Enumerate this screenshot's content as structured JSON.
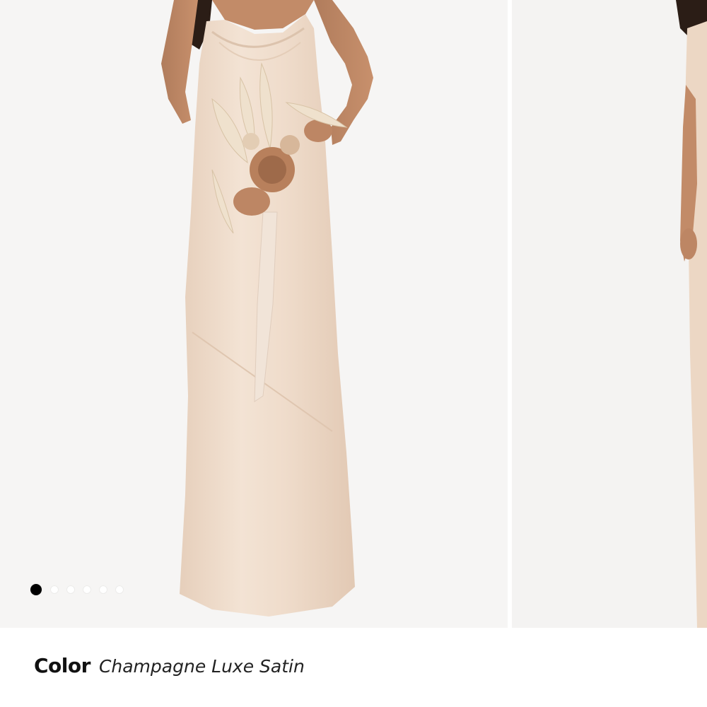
{
  "gallery": {
    "slides": [
      {
        "image": "model-champagne-satin-gown-front"
      },
      {
        "image": "model-champagne-satin-gown-side"
      }
    ],
    "pagination": {
      "total": 6,
      "active_index": 0
    }
  },
  "product": {
    "color_label": "Color",
    "color_value": "Champagne Luxe Satin"
  },
  "colors": {
    "background": "#ffffff",
    "photo_bg": "#f6f5f4",
    "dress": "#ecd9c7",
    "dot_active": "#000000",
    "dot_inactive": "#ffffff"
  }
}
